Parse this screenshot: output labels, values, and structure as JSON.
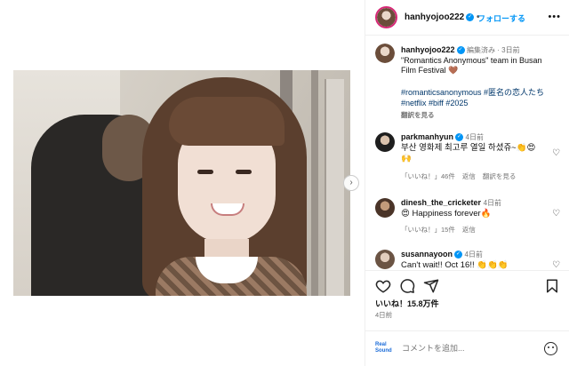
{
  "header": {
    "username": "hanhyojoo222",
    "separator": "•",
    "follow_label": "フォローする",
    "more_label": "•••"
  },
  "caption": {
    "username": "hanhyojoo222",
    "edited": "編集済み",
    "time": "3日前",
    "text_line1": "\"Romantics Anonymous\" team in Busan",
    "text_line2": "Film Festival 🤎",
    "tags_line1": "#romanticsanonymous #匿名の恋人たち",
    "tags_line2": "#netflix #biff #2025",
    "translate": "翻訳を見る"
  },
  "comments": [
    {
      "username": "parkmanhyun",
      "time": "4日前",
      "text": "부산 영화제 최고루 열일 하셨쥬~👏😍🙌",
      "likes_label": "「いいね！」46件",
      "reply": "返信",
      "translate": "翻訳を見る"
    },
    {
      "username": "dinesh_the_cricketer",
      "time": "4日前",
      "text": "😍 Happiness forever🔥",
      "likes_label": "「いいね！」15件",
      "reply": "返信"
    },
    {
      "username": "susannayoon",
      "time": "4日前",
      "text": "Can't wait!! Oct 16!! 👏👏👏",
      "likes_label": "",
      "reply": ""
    }
  ],
  "stats": {
    "likes": "いいね！15.8万件",
    "date": "4日前"
  },
  "comment_box": {
    "placeholder": "コメントを追加...",
    "brand_line1": "Real",
    "brand_line2": "Sound"
  },
  "icons": {
    "like": "heart-icon",
    "comment": "comment-icon",
    "share": "share-icon",
    "save": "bookmark-icon",
    "emoji": "emoji-icon",
    "next": "chevron-right-icon"
  },
  "colors": {
    "accent": "#0095f6",
    "link": "#00376b",
    "muted": "#737373"
  }
}
